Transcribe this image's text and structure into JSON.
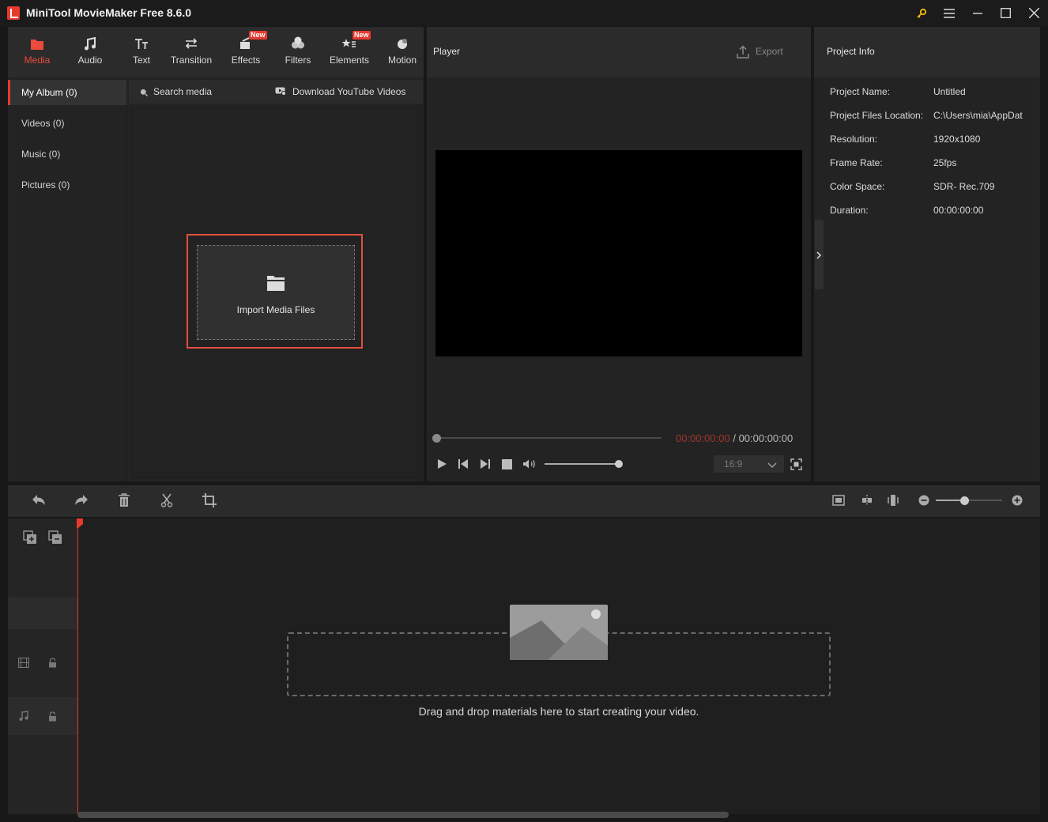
{
  "app": {
    "title": "MiniTool MovieMaker Free 8.6.0"
  },
  "toolbar": {
    "tabs": [
      {
        "label": "Media",
        "active": true
      },
      {
        "label": "Audio"
      },
      {
        "label": "Text"
      },
      {
        "label": "Transition"
      },
      {
        "label": "Effects",
        "badge": "New"
      },
      {
        "label": "Filters"
      },
      {
        "label": "Elements",
        "badge": "New"
      },
      {
        "label": "Motion"
      }
    ]
  },
  "library": {
    "albums": [
      {
        "label": "My Album (0)",
        "active": true
      },
      {
        "label": "Videos (0)"
      },
      {
        "label": "Music (0)"
      },
      {
        "label": "Pictures (0)"
      }
    ],
    "search_placeholder": "Search media",
    "download_label": "Download YouTube Videos",
    "import_label": "Import Media Files"
  },
  "player": {
    "title": "Player",
    "export_label": "Export",
    "current_time": "00:00:00:00",
    "separator": "/",
    "total_time": "00:00:00:00",
    "aspect_ratio": "16:9"
  },
  "project_info": {
    "title": "Project Info",
    "rows": [
      {
        "label": "Project Name:",
        "value": "Untitled"
      },
      {
        "label": "Project Files Location:",
        "value": "C:\\Users\\mia\\AppDat"
      },
      {
        "label": "Resolution:",
        "value": "1920x1080"
      },
      {
        "label": "Frame Rate:",
        "value": "25fps"
      },
      {
        "label": "Color Space:",
        "value": "SDR- Rec.709"
      },
      {
        "label": "Duration:",
        "value": "00:00:00:00"
      }
    ]
  },
  "timeline": {
    "drop_hint": "Drag and drop materials here to start creating your video."
  },
  "colors": {
    "accent": "#e63a2e",
    "panel": "#232323",
    "header": "#2b2b2b"
  }
}
